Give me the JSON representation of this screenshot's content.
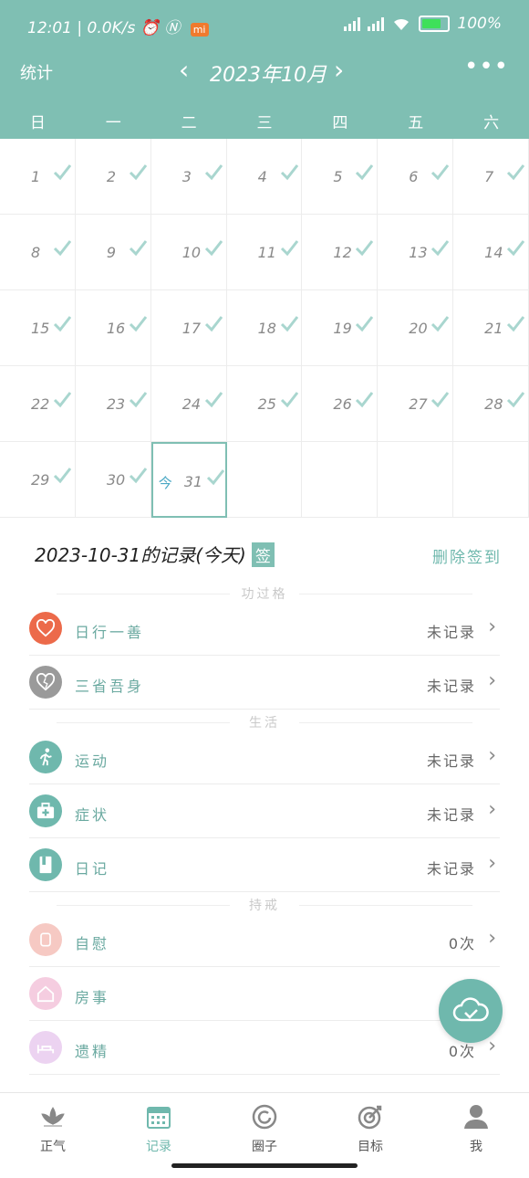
{
  "status_bar": {
    "time": "12:01",
    "net_speed": "0.0K/s",
    "mi_badge": "mi",
    "battery": "100%"
  },
  "header": {
    "stats_label": "统计",
    "month_title": "2023年10月",
    "prev": "‹",
    "next": "›",
    "more": "•••"
  },
  "weekdays": [
    "日",
    "一",
    "二",
    "三",
    "四",
    "五",
    "六"
  ],
  "calendar": {
    "days": [
      "1",
      "2",
      "3",
      "4",
      "5",
      "6",
      "7",
      "8",
      "9",
      "10",
      "11",
      "12",
      "13",
      "14",
      "15",
      "16",
      "17",
      "18",
      "19",
      "20",
      "21",
      "22",
      "23",
      "24",
      "25",
      "26",
      "27",
      "28",
      "29",
      "30",
      "31"
    ],
    "today_label": "今",
    "today_index": 30
  },
  "record": {
    "title": "2023-10-31的记录(今天)",
    "sign_badge": "签",
    "delete_sign": "删除签到"
  },
  "sections": [
    {
      "title": "功过格",
      "items": [
        {
          "label": "日行一善",
          "value": "未记录",
          "icon": "heart-icon",
          "color": "#ec6a4a"
        },
        {
          "label": "三省吾身",
          "value": "未记录",
          "icon": "broken-heart-icon",
          "color": "#9a9a9a"
        }
      ]
    },
    {
      "title": "生活",
      "items": [
        {
          "label": "运动",
          "value": "未记录",
          "icon": "running-icon",
          "color": "#6fb8ad"
        },
        {
          "label": "症状",
          "value": "未记录",
          "icon": "medkit-icon",
          "color": "#6fb8ad"
        },
        {
          "label": "日记",
          "value": "未记录",
          "icon": "diary-icon",
          "color": "#6fb8ad"
        }
      ]
    },
    {
      "title": "持戒",
      "items": [
        {
          "label": "自慰",
          "value": "0次",
          "icon": "hand-icon",
          "color": "#f6c9c3"
        },
        {
          "label": "房事",
          "value": "",
          "icon": "house-icon",
          "color": "#f5cde0"
        },
        {
          "label": "遗精",
          "value": "0次",
          "icon": "bed-icon",
          "color": "#ecd3f1"
        }
      ]
    }
  ],
  "nav": [
    {
      "label": "正气",
      "icon": "lotus-icon"
    },
    {
      "label": "记录",
      "icon": "calendar-icon"
    },
    {
      "label": "圈子",
      "icon": "circle-icon"
    },
    {
      "label": "目标",
      "icon": "target-icon"
    },
    {
      "label": "我",
      "icon": "user-icon"
    }
  ]
}
